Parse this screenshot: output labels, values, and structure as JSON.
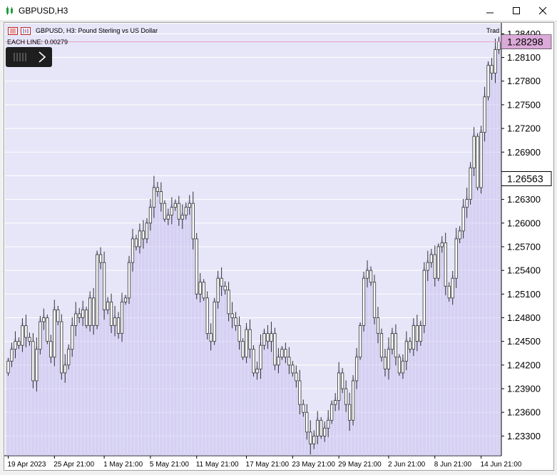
{
  "window": {
    "title": "GBPUSD,H3",
    "minimize_icon": "minimize-icon",
    "maximize_icon": "maximize-icon",
    "close_icon": "close-icon"
  },
  "chart_header": {
    "description": "GBPUSD, H3:  Pound Sterling vs US Dollar",
    "each_line": "EACH LINE: 0.00279",
    "right_label": "Trad"
  },
  "colors": {
    "background": "#e6e6f8",
    "grid": "#ffffff",
    "bar_fill": "#ffffff",
    "bar_border": "#303030",
    "volume_lines": "#c8c0ee",
    "current_price_line": "#e7a0c8",
    "current_price_box": "#dcaad9"
  },
  "chart_data": {
    "type": "candlestick",
    "symbol": "GBPUSD",
    "timeframe": "H3",
    "ylim": [
      1.2305,
      1.2853
    ],
    "y_ticks": [
      "1.28400",
      "1.28100",
      "1.27800",
      "1.27500",
      "1.27200",
      "1.26900",
      "1.26600",
      "1.26300",
      "1.26000",
      "1.25700",
      "1.25400",
      "1.25100",
      "1.24800",
      "1.24500",
      "1.24200",
      "1.23900",
      "1.23600",
      "1.23300"
    ],
    "current_price": "1.28298",
    "marked_price": "1.26563",
    "x_labels": [
      "19 Apr 2023",
      "25 Apr 21:00",
      "1 May 21:00",
      "5 May 21:00",
      "11 May 21:00",
      "17 May 21:00",
      "23 May 21:00",
      "29 May 21:00",
      "2 Jun 21:00",
      "8 Jun 21:00",
      "14 Jun 21:00"
    ],
    "closes": [
      1.2425,
      1.244,
      1.245,
      1.2445,
      1.247,
      1.2455,
      1.245,
      1.24,
      1.244,
      1.2475,
      1.248,
      1.245,
      1.243,
      1.249,
      1.2475,
      1.241,
      1.242,
      1.244,
      1.247,
      1.2485,
      1.248,
      1.249,
      1.247,
      1.2505,
      1.247,
      1.256,
      1.255,
      1.249,
      1.25,
      1.247,
      1.248,
      1.246,
      1.25,
      1.2505,
      1.255,
      1.258,
      1.257,
      1.259,
      1.258,
      1.26,
      1.262,
      1.2645,
      1.264,
      1.2625,
      1.2605,
      1.261,
      1.262,
      1.2625,
      1.2605,
      1.261,
      1.262,
      1.2625,
      1.258,
      1.251,
      1.2525,
      1.2505,
      1.246,
      1.245,
      1.25,
      1.253,
      1.252,
      1.2515,
      1.2485,
      1.248,
      1.247,
      1.245,
      1.243,
      1.2465,
      1.244,
      1.241,
      1.2415,
      1.2445,
      1.246,
      1.245,
      1.246,
      1.242,
      1.243,
      1.244,
      1.243,
      1.242,
      1.241,
      1.24,
      1.237,
      1.236,
      1.2335,
      1.232,
      1.233,
      1.235,
      1.233,
      1.234,
      1.235,
      1.237,
      1.2375,
      1.241,
      1.239,
      1.237,
      1.235,
      1.24,
      1.243,
      1.247,
      1.253,
      1.254,
      1.2525,
      1.248,
      1.246,
      1.243,
      1.2415,
      1.244,
      1.246,
      1.243,
      1.241,
      1.2425,
      1.245,
      1.244,
      1.247,
      1.245,
      1.247,
      1.254,
      1.255,
      1.256,
      1.253,
      1.257,
      1.2575,
      1.252,
      1.2505,
      1.253,
      1.258,
      1.259,
      1.262,
      1.263,
      1.267,
      1.271,
      1.2645,
      1.2715,
      1.276,
      1.28,
      1.279,
      1.282,
      1.283
    ]
  }
}
